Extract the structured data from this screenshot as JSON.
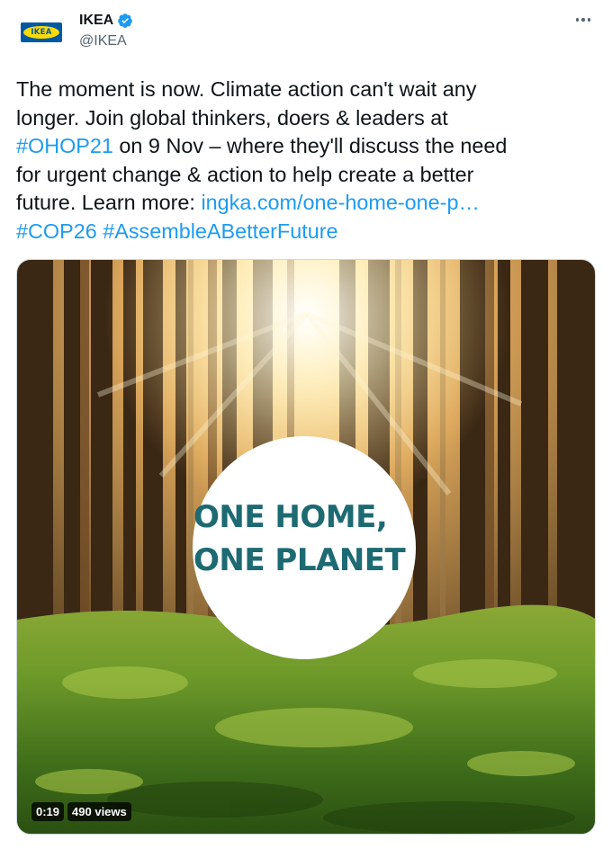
{
  "author": {
    "display_name": "IKEA",
    "handle": "@IKEA",
    "logo_text": "IKEA",
    "verified_icon": "verified-badge-icon",
    "more_icon": "more-options-icon"
  },
  "tweet": {
    "line1": "The moment is now. Climate action can't wait any",
    "line2": "longer. Join global thinkers, doers & leaders at",
    "line3_link": "#OHOP21",
    "line3_text": " on 9 Nov – where they'll discuss the need",
    "line4": "for urgent change & action to help create a better",
    "line5_text": "future. Learn more: ",
    "line5_link": "ingka.com/one-home-one-p…",
    "hashtag1": "#COP26",
    "hashtag2": "#AssembleABetterFuture"
  },
  "media": {
    "title_line1": "ONE HOME,",
    "title_line2": "ONE PLANET",
    "duration": "0:19",
    "views": "490 views"
  },
  "colors": {
    "link": "#1d9bf0",
    "ikea_blue": "#0058a3",
    "ikea_yellow": "#ffdb00",
    "title_teal": "#1d6a73"
  }
}
